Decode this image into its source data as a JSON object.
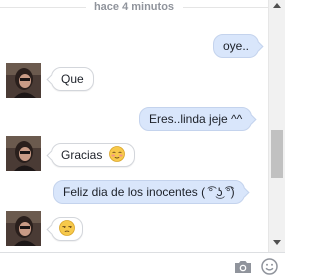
{
  "chat": {
    "timestamp": "hace 4 minutos",
    "messages": [
      {
        "from": "me",
        "text": "oye.."
      },
      {
        "from": "them",
        "text": "Que"
      },
      {
        "from": "me",
        "text": "Eres..linda jeje ^^"
      },
      {
        "from": "them",
        "text": "Gracias",
        "emoji": "blush-emoji"
      },
      {
        "from": "me",
        "text": "Feliz dia de los inocentes ( ͡° ͜ʖ ͡°)"
      },
      {
        "from": "them",
        "text": "",
        "emoji": "unamused-emoji"
      }
    ]
  },
  "composer": {
    "placeholder": "",
    "value": "",
    "camera_icon": "camera-icon",
    "emoji_icon": "smiley-icon"
  },
  "colors": {
    "outgoing_bubble": "#d9e6fb",
    "incoming_bubble": "#ffffff",
    "timestamp": "#90949c"
  }
}
